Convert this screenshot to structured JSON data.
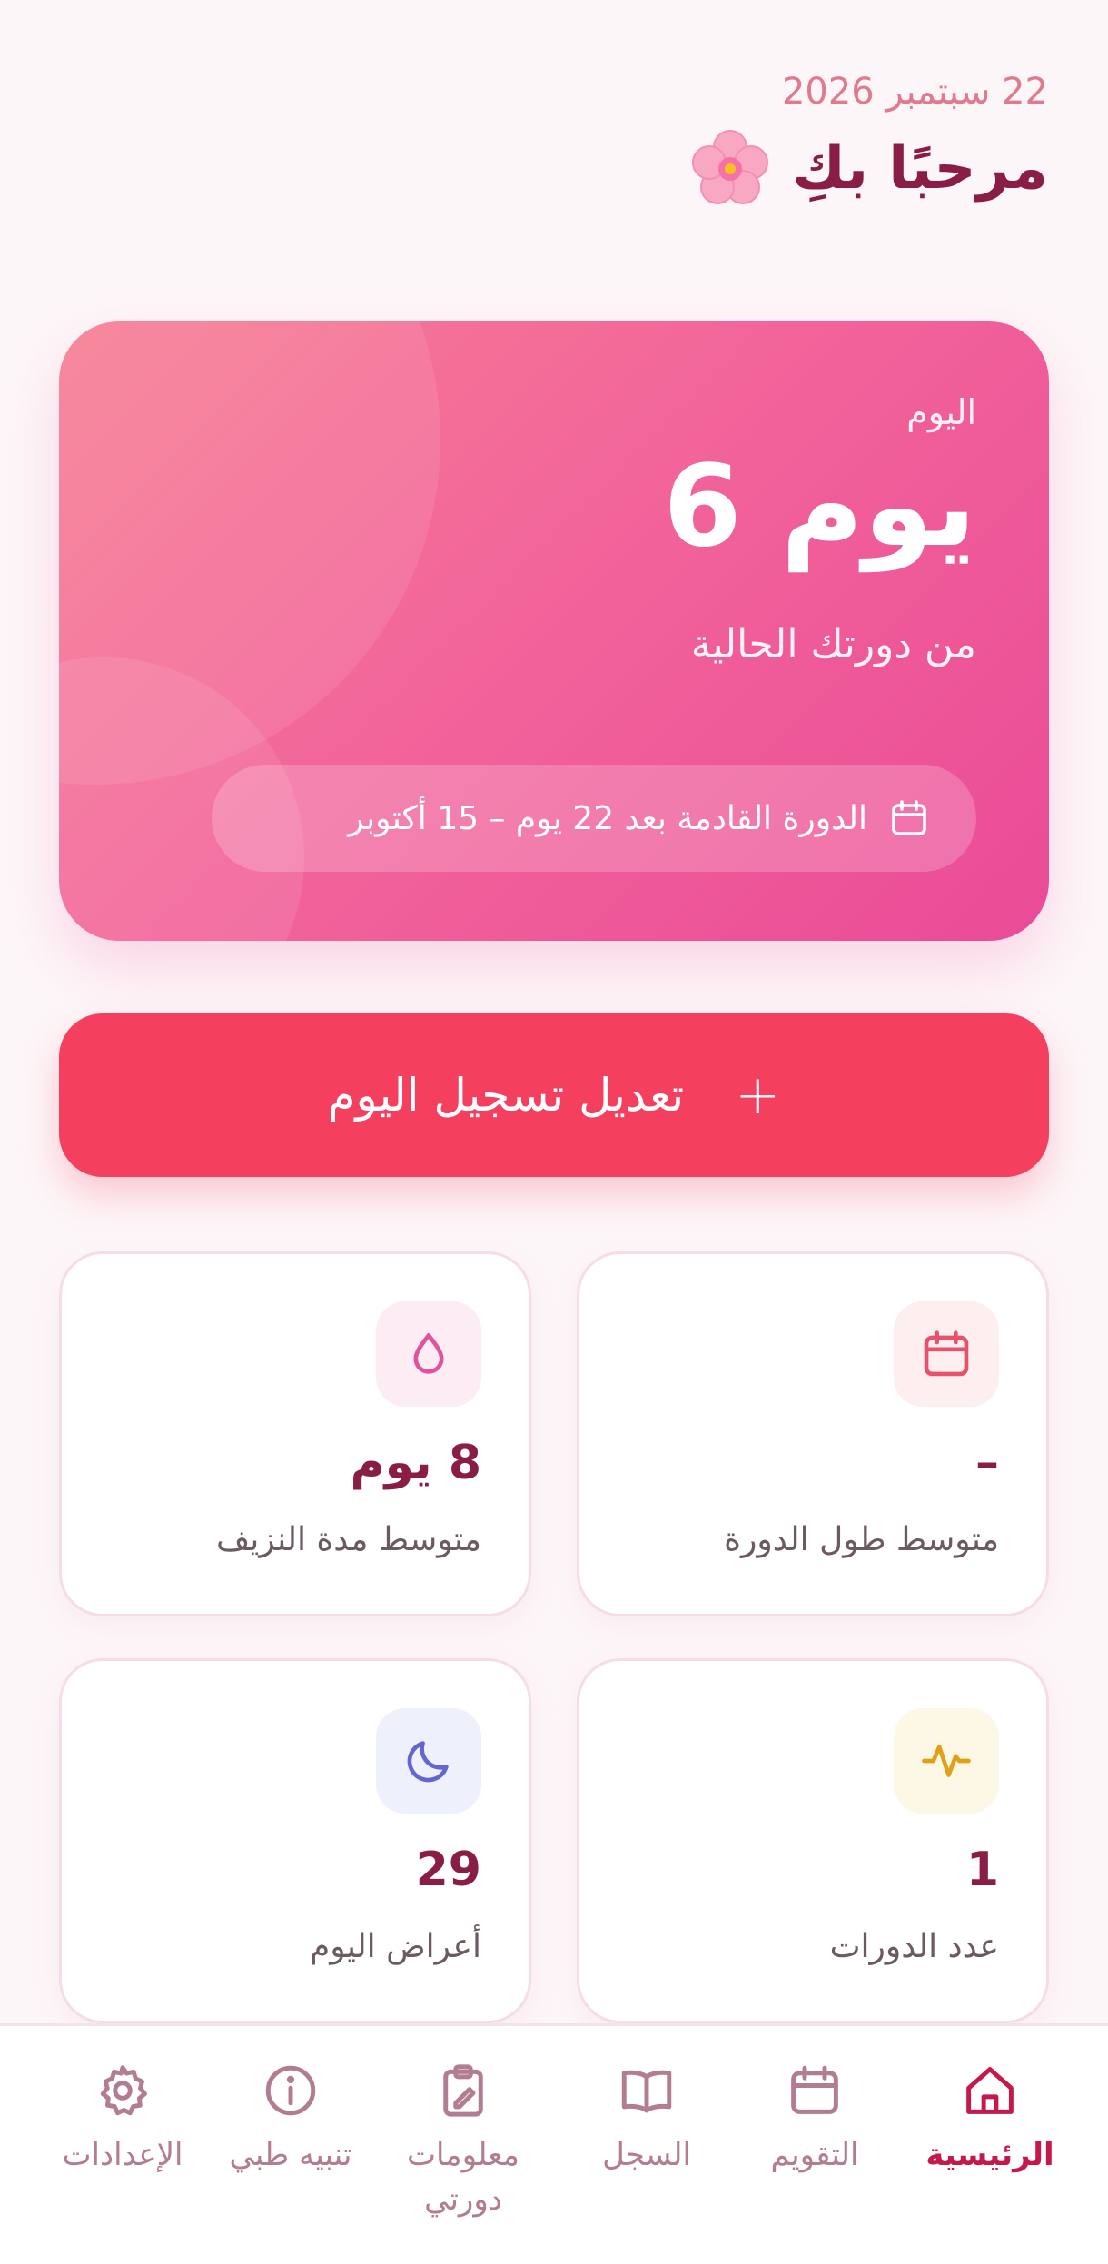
{
  "header": {
    "date": "22 سبتمبر 2026",
    "greeting": "مرحبًا بكِ"
  },
  "hero": {
    "label": "اليوم",
    "day": "يوم 6",
    "subtitle": "من دورتك الحالية",
    "next_period": "الدورة القادمة بعد 22 يوم – 15 أكتوبر"
  },
  "log_button": {
    "plus": "+",
    "label": "تعديل تسجيل اليوم"
  },
  "stats": [
    {
      "icon": "calendar-icon",
      "value": "–",
      "label": "متوسط طول الدورة",
      "color": "#e8506b",
      "bg": "#fdeef0"
    },
    {
      "icon": "drop-icon",
      "value": "8 يوم",
      "label": "متوسط مدة النزيف",
      "color": "#e0529c",
      "bg": "#fcedf5"
    },
    {
      "icon": "activity-icon",
      "value": "1",
      "label": "عدد الدورات",
      "color": "#e0a019",
      "bg": "#fdf8e6"
    },
    {
      "icon": "moon-icon",
      "value": "29",
      "label": "أعراض اليوم",
      "color": "#6366d1",
      "bg": "#eef0fc"
    }
  ],
  "nav": [
    {
      "label": "الرئيسية",
      "icon": "home-icon",
      "active": true
    },
    {
      "label": "التقويم",
      "icon": "calendar-icon"
    },
    {
      "label": "السجل",
      "icon": "book-icon"
    },
    {
      "label": "معلومات دورتي",
      "icon": "clipboard-icon"
    },
    {
      "label": "تنبيه طبي",
      "icon": "info-icon"
    },
    {
      "label": "الإعدادات",
      "icon": "gear-icon"
    }
  ]
}
